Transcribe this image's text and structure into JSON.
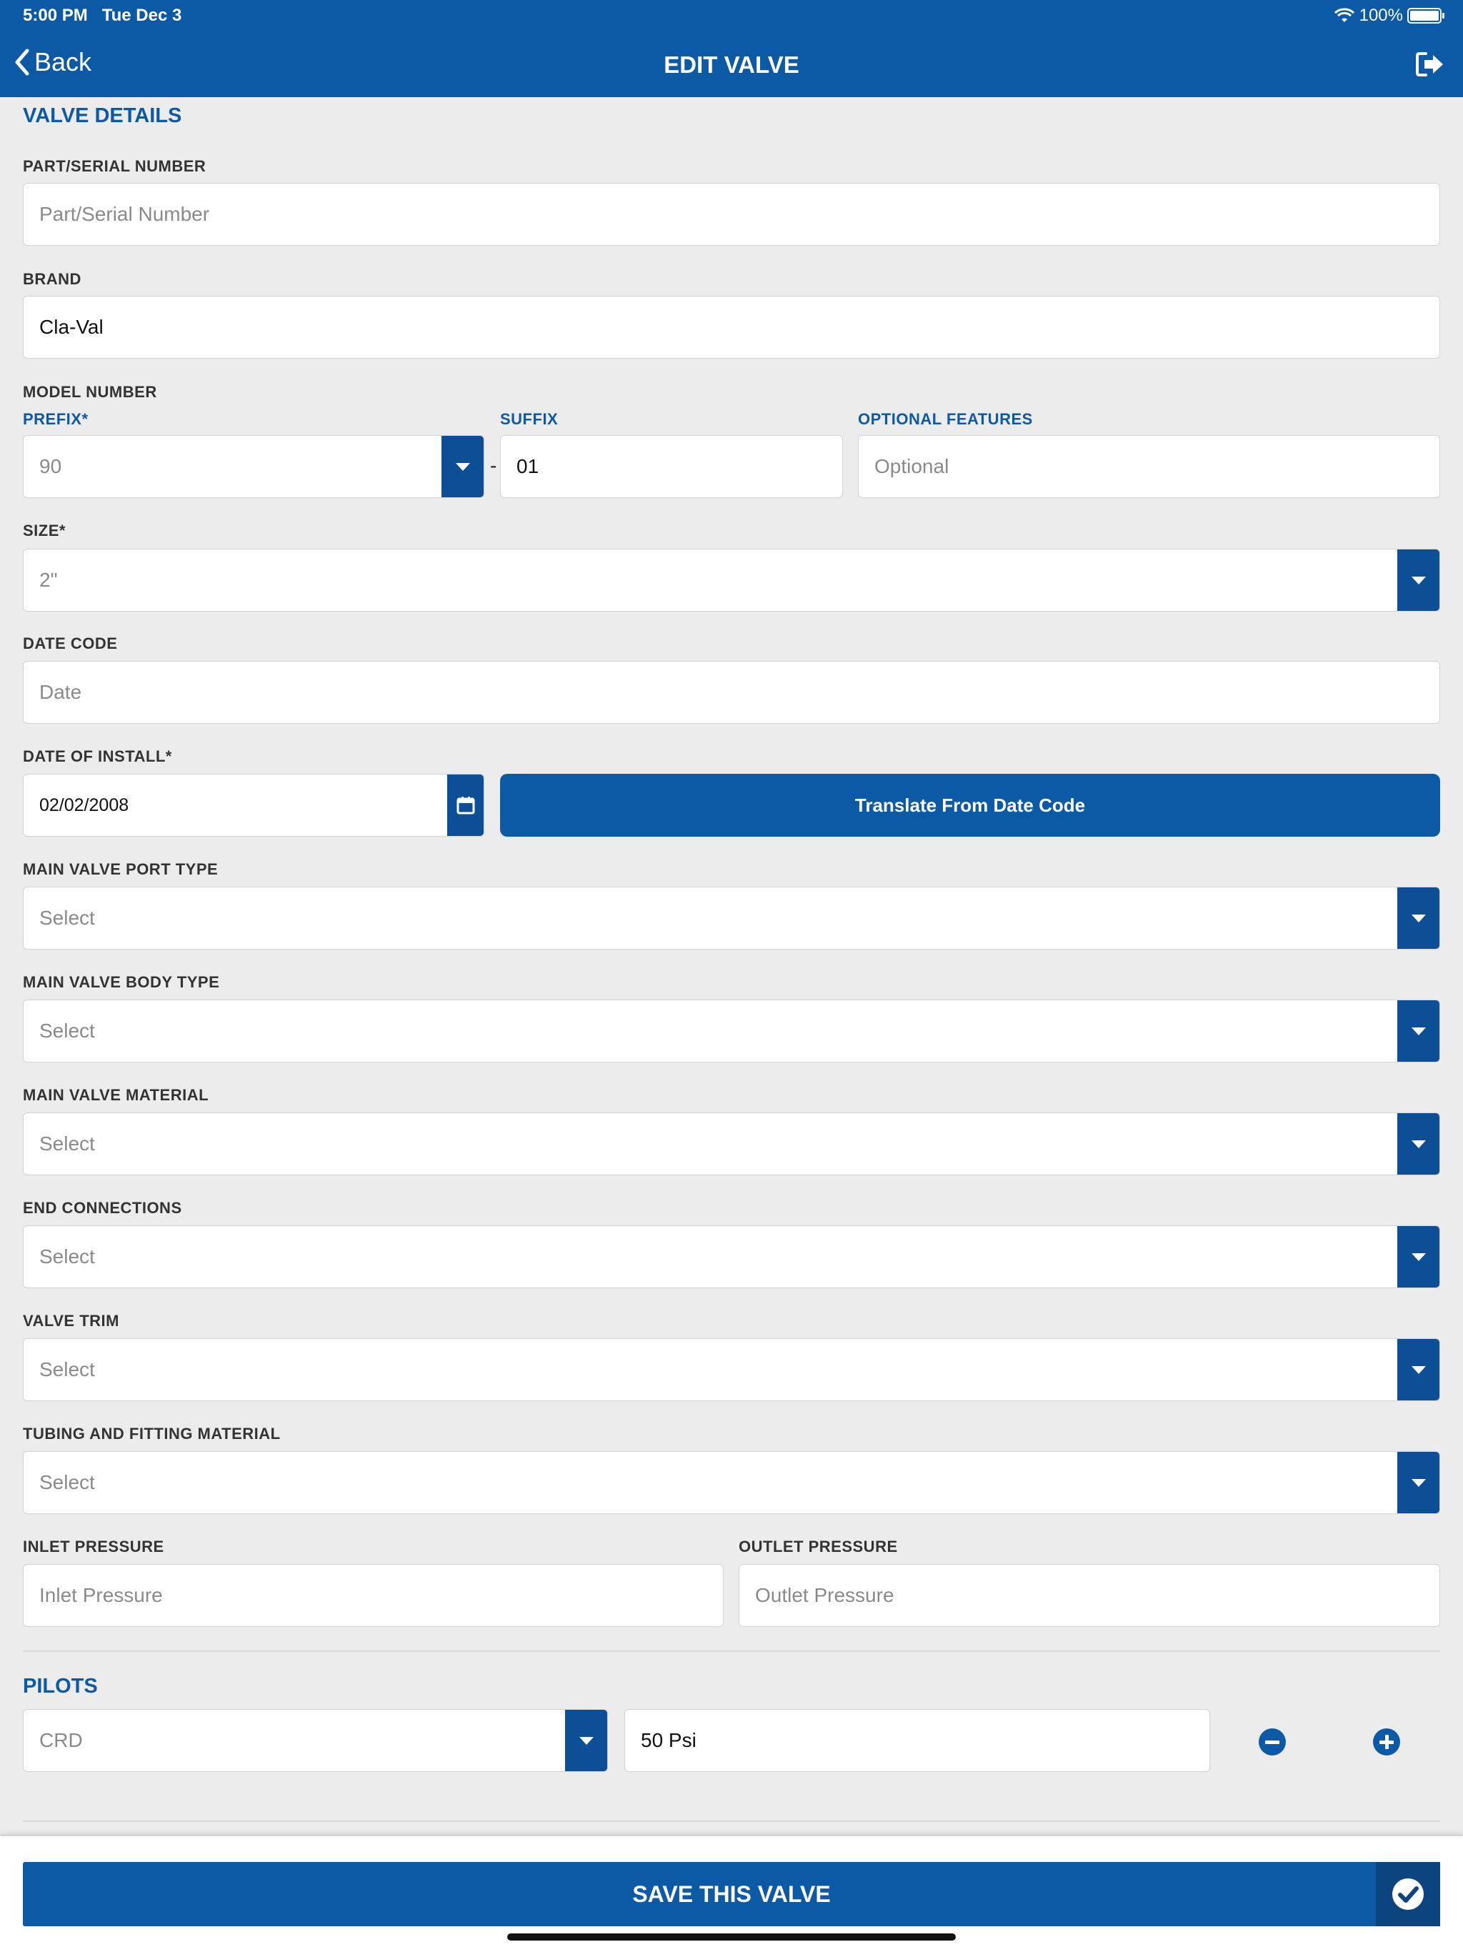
{
  "status_bar": {
    "time": "5:00 PM",
    "date": "Tue Dec 3",
    "battery": "100%"
  },
  "nav": {
    "back_label": "Back",
    "title": "EDIT VALVE",
    "icon": "logout-icon"
  },
  "valve_details": {
    "section_title": "VALVE DETAILS",
    "part_serial": {
      "label": "PART/SERIAL NUMBER",
      "value": "",
      "placeholder": "Part/Serial Number"
    },
    "brand": {
      "label": "BRAND",
      "value": "Cla-Val"
    },
    "model_number": {
      "label": "MODEL NUMBER",
      "prefix": {
        "label": "PREFIX*",
        "value": "90"
      },
      "separator": "-",
      "suffix": {
        "label": "SUFFIX",
        "value": "01"
      },
      "optional_features": {
        "label": "OPTIONAL FEATURES",
        "placeholder": "Optional"
      }
    },
    "size": {
      "label": "SIZE*",
      "value": "2\""
    },
    "date_code": {
      "label": "DATE CODE",
      "placeholder": "Date"
    },
    "date_of_install": {
      "label": "DATE OF INSTALL*",
      "value": "02/02/2008",
      "translate_button": "Translate From Date Code"
    },
    "main_valve_port_type": {
      "label": "MAIN VALVE PORT TYPE",
      "value": "Select"
    },
    "main_valve_body_type": {
      "label": "MAIN VALVE BODY TYPE",
      "value": "Select"
    },
    "main_valve_material": {
      "label": "MAIN VALVE MATERIAL",
      "value": "Select"
    },
    "end_connections": {
      "label": "END CONNECTIONS",
      "value": "Select"
    },
    "valve_trim": {
      "label": "VALVE TRIM",
      "value": "Select"
    },
    "tubing_fitting_material": {
      "label": "TUBING AND FITTING MATERIAL",
      "value": "Select"
    },
    "inlet_pressure": {
      "label": "INLET PRESSURE",
      "placeholder": "Inlet Pressure"
    },
    "outlet_pressure": {
      "label": "OUTLET PRESSURE",
      "placeholder": "Outlet Pressure"
    }
  },
  "pilots": {
    "section_title": "PILOTS",
    "items": [
      {
        "type": "CRD",
        "setting": "50 Psi"
      }
    ]
  },
  "footer": {
    "save_label": "SAVE THIS VALVE"
  },
  "colors": {
    "primary": "#0c5aa6",
    "primary_dark": "#0c4f96",
    "background": "#ececec"
  }
}
